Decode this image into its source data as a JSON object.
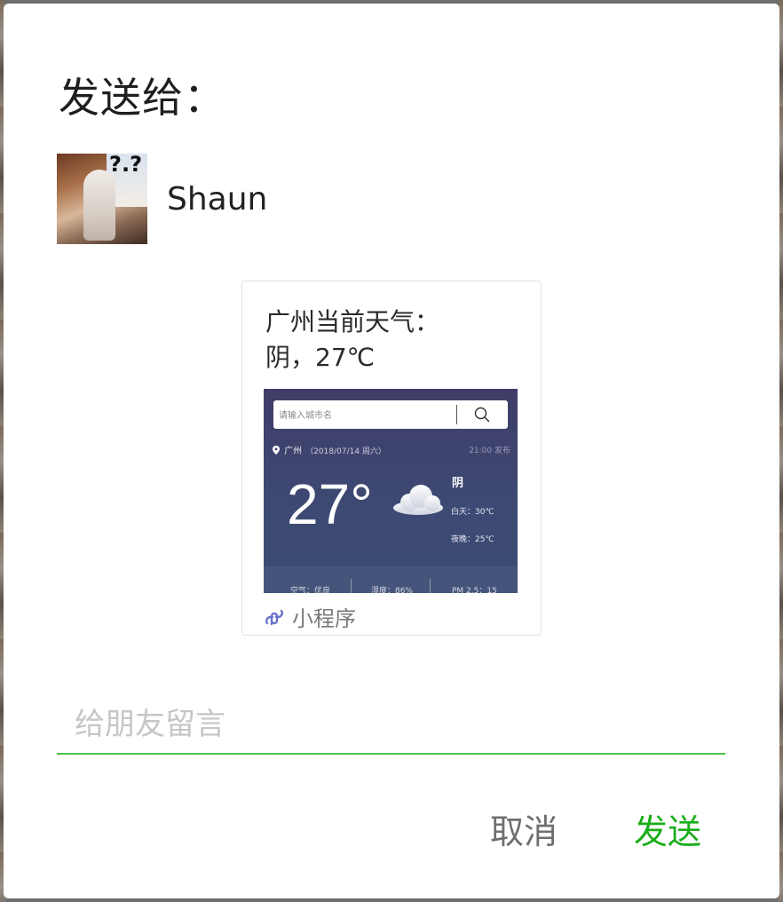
{
  "dialog": {
    "title": "发送给：",
    "recipient": {
      "name": "Shaun"
    },
    "card": {
      "title_line1": "广州当前天气：",
      "title_line2": "阴，27℃",
      "preview": {
        "search_placeholder": "请输入城市名",
        "city": "广州",
        "date": "（2018/07/14 周六）",
        "update_time": "21:00 发布",
        "temperature": "27°",
        "condition": "阴",
        "day_temp": "白天：30℃",
        "night_temp": "夜晚：25℃",
        "air_quality": "空气：优良",
        "humidity": "湿度：86%",
        "pm25": "PM 2.5：15"
      },
      "source_label": "小程序"
    },
    "message_placeholder": "给朋友留言",
    "cancel_label": "取消",
    "send_label": "发送",
    "colors": {
      "accent": "#1aad19",
      "input_underline": "#4cc04a",
      "preview_bg": "#3d4a74"
    }
  }
}
